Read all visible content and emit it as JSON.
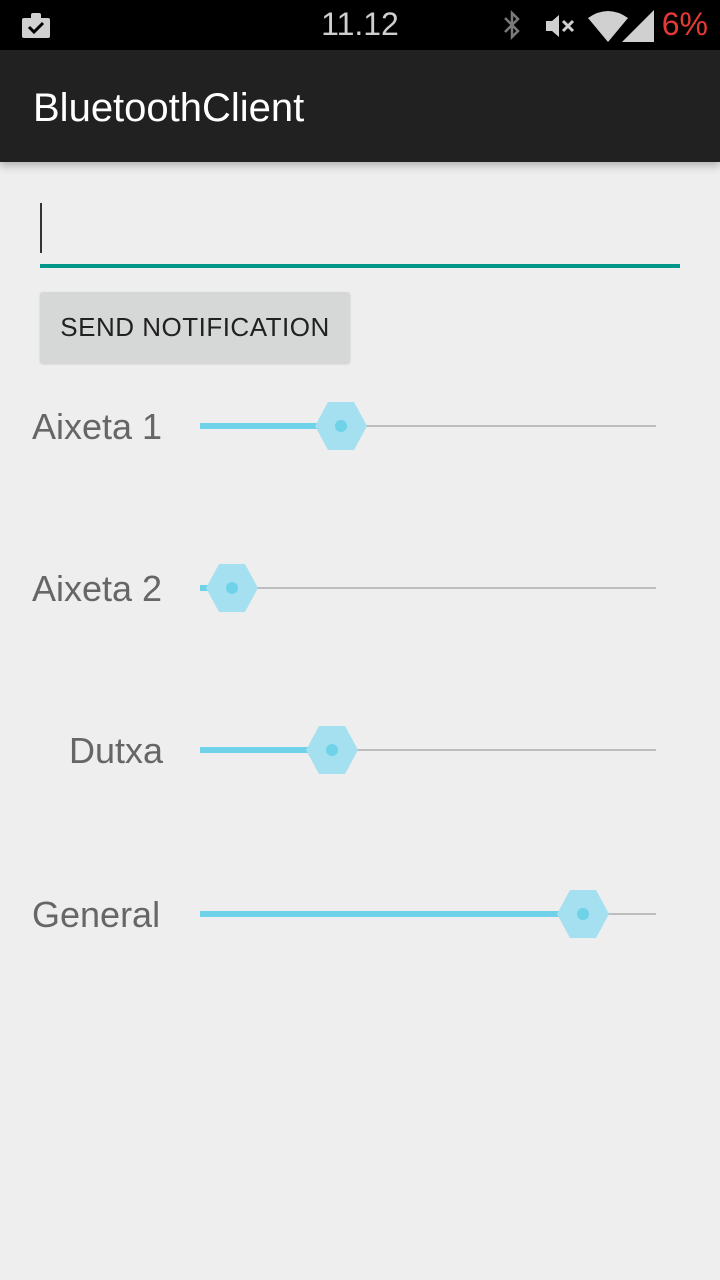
{
  "status_bar": {
    "time": "11.12",
    "battery": "6%",
    "icons": [
      "clipboard-check-icon",
      "bluetooth-icon",
      "mute-icon",
      "wifi-icon",
      "signal-icon"
    ]
  },
  "app_bar": {
    "title": "BluetoothClient"
  },
  "message_input": {
    "value": "",
    "placeholder": ""
  },
  "send_button": {
    "label": "SEND NOTIFICATION"
  },
  "sliders": [
    {
      "label": "Aixeta 1",
      "value": 0.31
    },
    {
      "label": "Aixeta 2",
      "value": 0.07
    },
    {
      "label": "Dutxa",
      "value": 0.29
    },
    {
      "label": "General",
      "value": 0.84
    }
  ],
  "colors": {
    "accent": "#009688",
    "slider": "#6fd2e8",
    "slider_thumb": "#a4e0ef",
    "battery_low": "#e53935",
    "app_bar": "#212121"
  }
}
